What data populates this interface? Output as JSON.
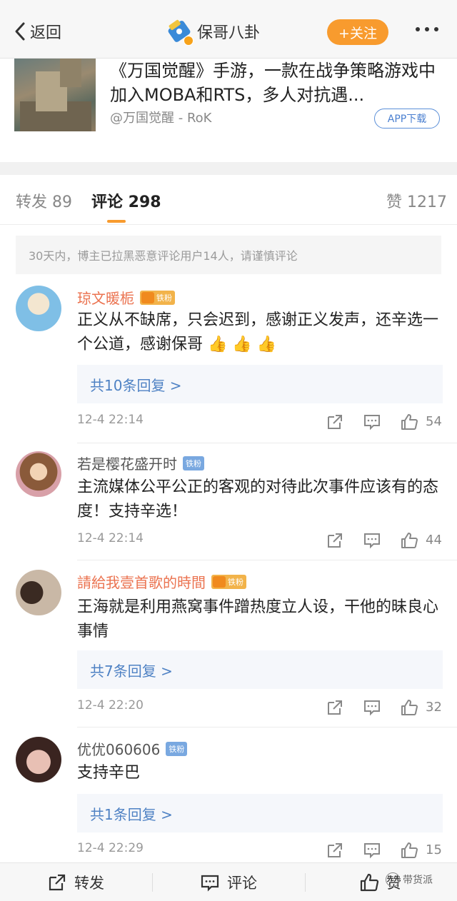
{
  "nav": {
    "back_label": "返回",
    "title": "保哥八卦",
    "follow_label": "+关注"
  },
  "app_card": {
    "title": "《万国觉醒》手游，一款在战争策略游戏中加入MOBA和RTS，多人对抗遇...",
    "subtitle": "@万国觉醒 - RoK",
    "download_label": "APP下载"
  },
  "tabs": {
    "repost": "转发 89",
    "comment": "评论 298",
    "like": "赞 1217"
  },
  "notice": "30天内，博主已拉黑恶意评论用户14人，请谨慎评论",
  "comments": [
    {
      "name": "琼文暖栀",
      "badge": "铁粉",
      "text": "正义从不缺席，只会迟到，感谢正义发声，还辛选一个公道，感谢保哥 👍 👍 👍",
      "replies": "共10条回复 >",
      "time": "12-4 22:14",
      "likes": "54"
    },
    {
      "name": "若是樱花盛开时",
      "badge": "铁粉",
      "text": "主流媒体公平公正的客观的对待此次事件应该有的态度！支持辛选！",
      "replies": "",
      "time": "12-4 22:14",
      "likes": "44"
    },
    {
      "name": "請給我壹首歌的時間",
      "badge": "铁粉",
      "text": "王海就是利用燕窝事件蹭热度立人设，干他的昧良心事情",
      "replies": "共7条回复 >",
      "time": "12-4 22:20",
      "likes": "32"
    },
    {
      "name": "优优060606",
      "badge": "铁粉",
      "text": "支持辛巴",
      "replies": "共1条回复 >",
      "time": "12-4 22:29",
      "likes": "15"
    }
  ],
  "bottom_bar": {
    "repost": "转发",
    "comment": "评论",
    "like": "赞"
  },
  "watermark": "带货派",
  "colors": {
    "accent": "#f89b2e",
    "link": "#4f82c4",
    "name_orange": "#eb7350"
  }
}
